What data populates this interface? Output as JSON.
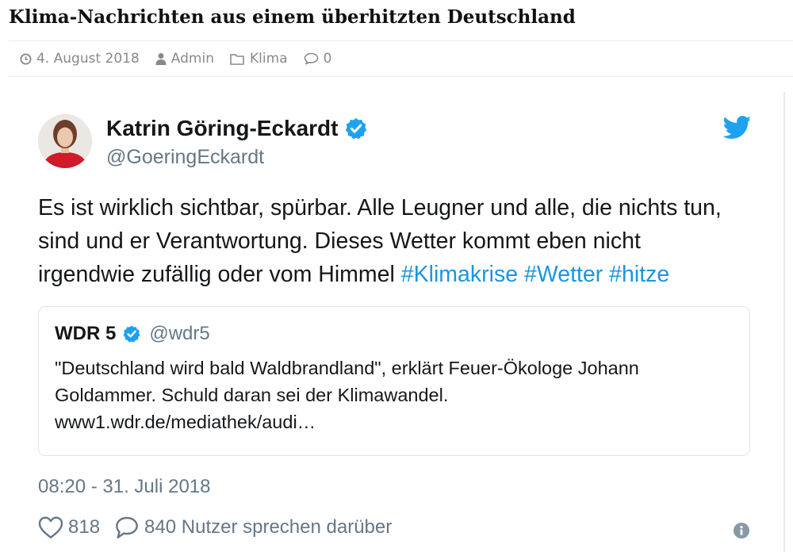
{
  "post": {
    "title": "Klima-Nachrichten aus einem überhitzten Deutschland",
    "meta": {
      "date": "4. August 2018",
      "author": "Admin",
      "category": "Klima",
      "comments": "0"
    }
  },
  "tweet": {
    "author_name": "Katrin Göring-Eckardt",
    "handle": "@GoeringEckardt",
    "text": "Es ist wirklich sichtbar, spürbar. Alle Leugner und alle, die nichts tun, sind und er Verantwortung. Dieses Wetter kommt eben nicht irgendwie zufällig oder vom Himmel ",
    "hashtags": [
      "#Klimakrise",
      "#Wetter",
      "#hitze"
    ],
    "quoted": {
      "name": "WDR 5",
      "handle": "@wdr5",
      "text_line1": "\"Deutschland wird bald Waldbrandland\", erklärt Feuer-Ökologe Johann",
      "text_line2": "Goldammer. Schuld daran sei der Klimawandel.",
      "text_line3": "www1.wdr.de/mediathek/audi…"
    },
    "timestamp": "08:20 - 31. Juli 2018",
    "likes": "818",
    "replies_text": "840 Nutzer sprechen darüber"
  },
  "colors": {
    "twitter_blue": "#1da1f2",
    "hashtag_blue": "#1b95e0",
    "meta_gray": "#8a8a8a",
    "secondary_text": "#657786"
  },
  "icons": [
    "clock-icon",
    "user-icon",
    "folder-icon",
    "comment-icon",
    "verified-badge-icon",
    "twitter-bird-icon",
    "heart-icon",
    "reply-icon",
    "info-icon"
  ]
}
